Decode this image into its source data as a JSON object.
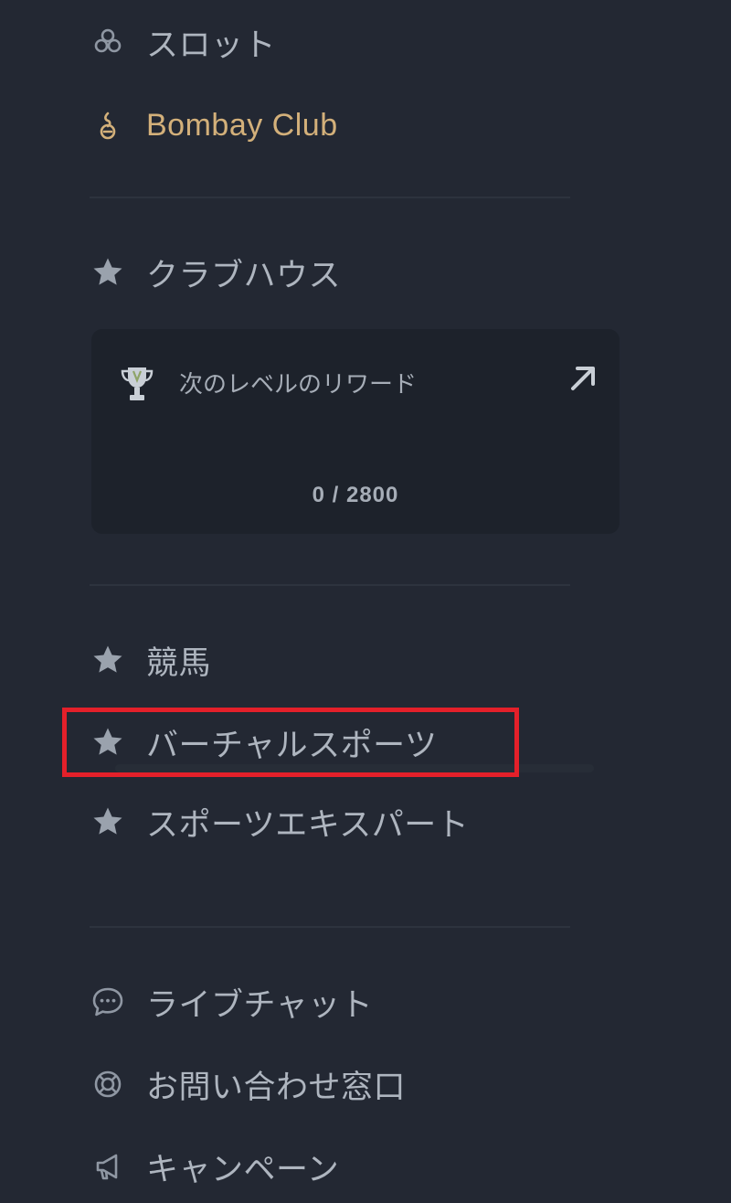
{
  "menu": {
    "slots": {
      "label": "スロット",
      "icon": "clover-icon"
    },
    "bombay": {
      "label": "Bombay Club",
      "icon": "bombay-club-icon"
    },
    "clubhouse": {
      "label": "クラブハウス",
      "icon": "star-icon"
    },
    "horse_racing": {
      "label": "競馬",
      "icon": "star-icon"
    },
    "virtual_sports": {
      "label": "バーチャルスポーツ",
      "icon": "star-icon"
    },
    "sports_expert": {
      "label": "スポーツエキスパート",
      "icon": "star-icon"
    },
    "live_chat": {
      "label": "ライブチャット",
      "icon": "chat-bubble-icon"
    },
    "support": {
      "label": "お問い合わせ窓口",
      "icon": "lifebuoy-icon"
    },
    "campaign": {
      "label": "キャンペーン",
      "icon": "megaphone-icon"
    }
  },
  "reward": {
    "title": "次のレベルのリワード",
    "counter": "0 / 2800",
    "current": 0,
    "target": 2800,
    "icon": "trophy-icon",
    "link_icon": "arrow-up-right-icon"
  },
  "colors": {
    "background": "#232833",
    "card": "#1d222b",
    "text": "#aeb5bf",
    "gold": "#d3b07a",
    "highlight": "#e4202a"
  }
}
